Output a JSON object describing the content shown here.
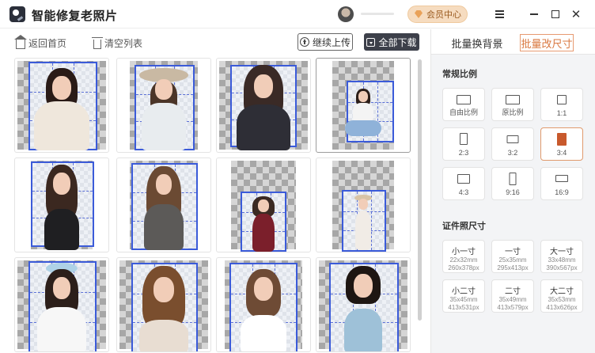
{
  "app": {
    "title": "智能修复老照片"
  },
  "header": {
    "vip_label": "会员中心"
  },
  "toolbar": {
    "home_label": "返回首页",
    "clear_label": "清空列表",
    "upload_label": "继续上传",
    "download_label": "全部下载"
  },
  "tabs": {
    "bg_label": "批量换背景",
    "size_label": "批量改尺寸"
  },
  "ratio_section": {
    "title": "常规比例",
    "items": [
      {
        "label": "自由比例"
      },
      {
        "label": "原比例"
      },
      {
        "label": "1:1"
      },
      {
        "label": "2:3"
      },
      {
        "label": "3:2"
      },
      {
        "label": "3:4"
      },
      {
        "label": "4:3"
      },
      {
        "label": "9:16"
      },
      {
        "label": "16:9"
      }
    ],
    "selected": "3:4"
  },
  "id_section": {
    "title": "证件照尺寸",
    "items": [
      {
        "name": "小一寸",
        "mm": "22x32mm",
        "px": "260x378px"
      },
      {
        "name": "一寸",
        "mm": "25x35mm",
        "px": "295x413px"
      },
      {
        "name": "大一寸",
        "mm": "33x48mm",
        "px": "390x567px"
      },
      {
        "name": "小二寸",
        "mm": "35x45mm",
        "px": "413x531px"
      },
      {
        "name": "二寸",
        "mm": "35x49mm",
        "px": "413x579px"
      },
      {
        "name": "大二寸",
        "mm": "35x53mm",
        "px": "413x626px"
      }
    ]
  },
  "colors": {
    "accent": "#e79a71",
    "crop_border": "#3b5bd9",
    "dark_button": "#3d404a"
  }
}
